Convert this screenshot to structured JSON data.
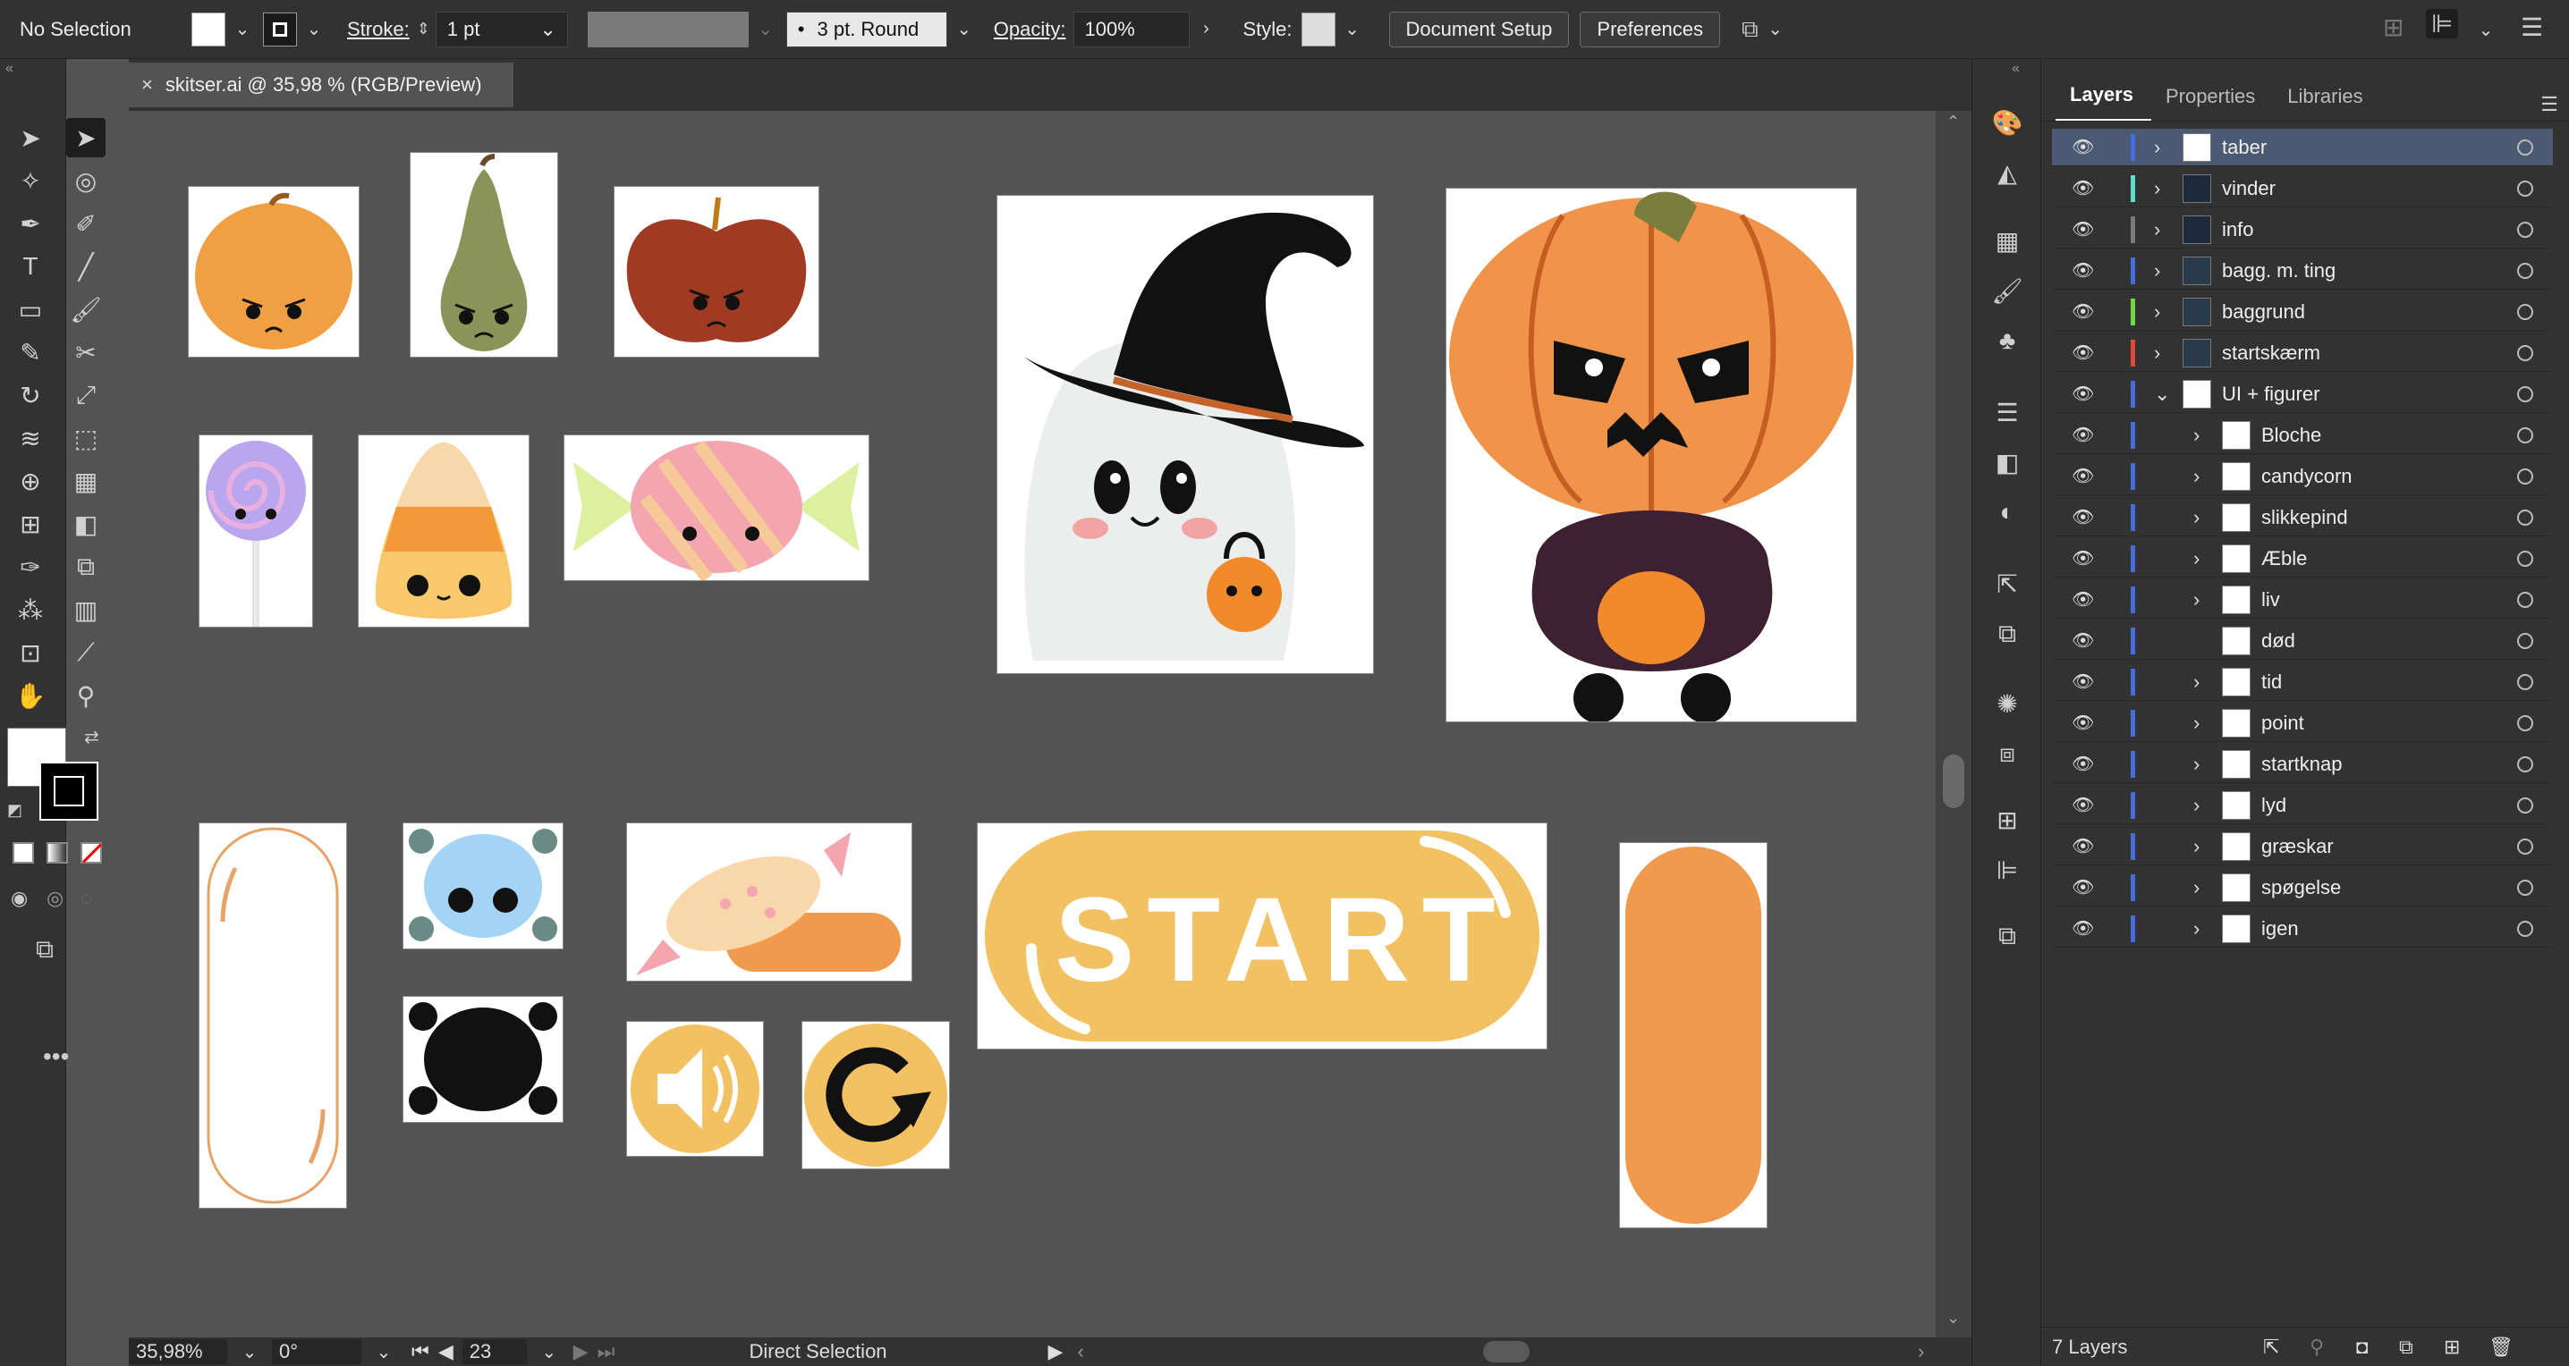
{
  "control_bar": {
    "selection": "No Selection",
    "stroke_label": "Stroke:",
    "stroke_weight": "1 pt",
    "brush": "3 pt. Round",
    "opacity_label": "Opacity:",
    "opacity_value": "100%",
    "style_label": "Style:",
    "document_setup": "Document Setup",
    "preferences": "Preferences"
  },
  "document": {
    "tab_title": "skitser.ai @ 35,98 % (RGB/Preview)"
  },
  "artboards": {
    "start_label": "START"
  },
  "status_bar": {
    "zoom": "35,98%",
    "rotation": "0°",
    "artboard_number": "23",
    "tool": "Direct Selection"
  },
  "layers_panel": {
    "tabs": [
      "Layers",
      "Properties",
      "Libraries"
    ],
    "layers": [
      {
        "name": "taber",
        "color": "#4a6be0"
      },
      {
        "name": "vinder",
        "color": "#5de0c8"
      },
      {
        "name": "info",
        "color": "#7a7a7a"
      },
      {
        "name": "bagg. m. ting",
        "color": "#4a6be0"
      },
      {
        "name": "baggrund",
        "color": "#6ddc3a"
      },
      {
        "name": "startskærm",
        "color": "#e04a3a"
      },
      {
        "name": "UI + figurer",
        "color": "#4a6be0"
      }
    ],
    "sublayers": [
      "Bloche",
      "candycorn",
      "slikkepind",
      "Æble",
      "liv",
      "død",
      "tid",
      "point",
      "startknap",
      "lyd",
      "græskar",
      "spøgelse",
      "igen"
    ],
    "footer_count": "7 Layers"
  }
}
